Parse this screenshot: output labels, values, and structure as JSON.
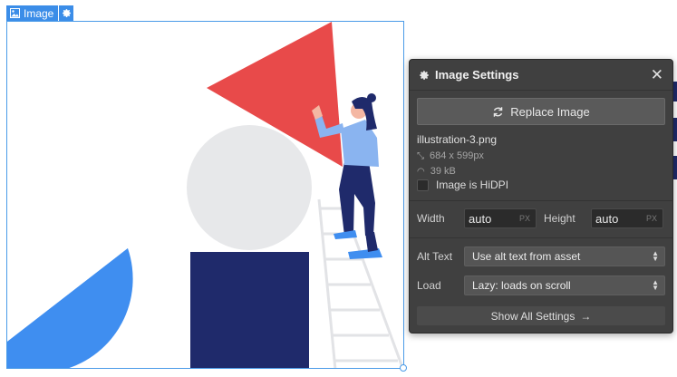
{
  "element_tag": {
    "label": "Image",
    "icon": "image-icon",
    "settings_icon": "gear-icon"
  },
  "panel": {
    "title": "Image Settings",
    "header_icon": "gear-icon",
    "close_icon": "close-icon",
    "replace_button": "Replace Image",
    "file": {
      "name": "illustration-3.png",
      "dimensions": "684 x 599px",
      "size": "39 kB"
    },
    "hidpi_label": "Image is HiDPI",
    "hidpi_checked": false,
    "width": {
      "label": "Width",
      "value": "auto",
      "unit": "PX"
    },
    "height": {
      "label": "Height",
      "value": "auto",
      "unit": "PX"
    },
    "alt_text": {
      "label": "Alt Text",
      "selected": "Use alt text from asset"
    },
    "load": {
      "label": "Load",
      "selected": "Lazy: loads on scroll"
    },
    "show_all": "Show All Settings",
    "show_all_icon": "arrow-right-icon"
  },
  "colors": {
    "accent": "#3b8de8",
    "panel_bg": "#404040",
    "triangle": "#e84a4a",
    "half_circle": "#3f8ef0",
    "navy": "#1f2a6b",
    "light_blue": "#8ab4f0"
  }
}
